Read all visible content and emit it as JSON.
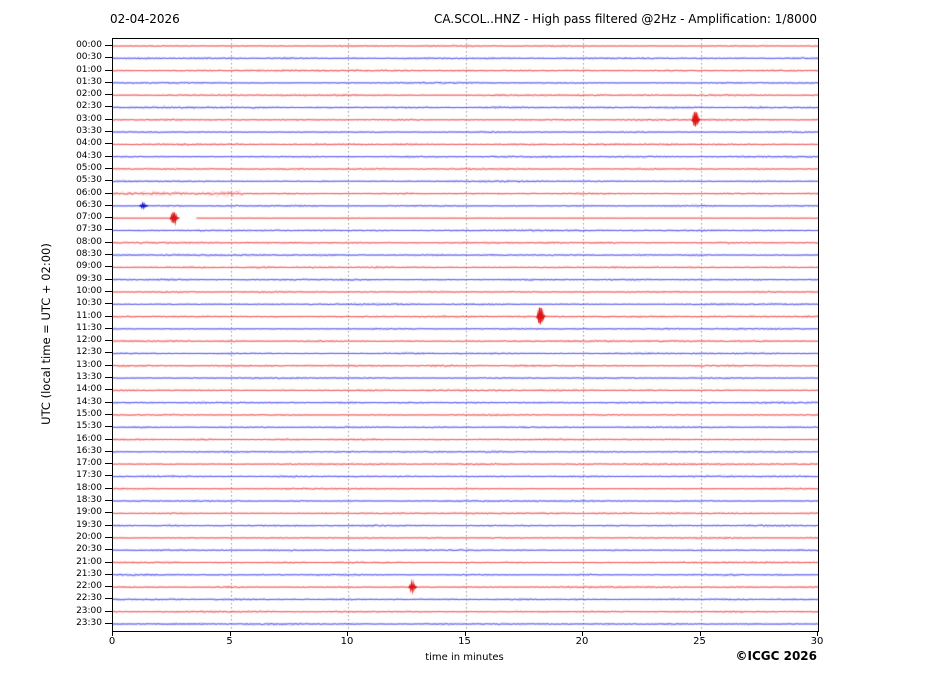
{
  "chart_data": {
    "type": "helicorder-seismogram",
    "title_left": "02-04-2026",
    "title_right": "CA.SCOL..HNZ - High pass filtered @2Hz - Amplification: 1/8000",
    "ylabel": "UTC (local time = UTC + 02:00)",
    "xlabel": "time in minutes",
    "copyright": "©ICGC 2026",
    "xlim": [
      0,
      30
    ],
    "xticks": [
      0,
      5,
      10,
      15,
      20,
      25,
      30
    ],
    "grid_minutes": [
      5,
      10,
      15,
      20,
      25
    ],
    "minutes_per_row": 30,
    "grid_on": true,
    "colors": {
      "hour_trace": "#ee3a3a",
      "half_trace": "#3a3aee",
      "event_red": "#dd1414",
      "event_blue": "#1414cc",
      "grid": "#999999",
      "axis": "#000000",
      "background": "#ffffff"
    },
    "rows": [
      {
        "label": "00:00",
        "color": "red"
      },
      {
        "label": "00:30",
        "color": "blue"
      },
      {
        "label": "01:00",
        "color": "red"
      },
      {
        "label": "01:30",
        "color": "blue"
      },
      {
        "label": "02:00",
        "color": "red"
      },
      {
        "label": "02:30",
        "color": "blue"
      },
      {
        "label": "03:00",
        "color": "red"
      },
      {
        "label": "03:30",
        "color": "blue"
      },
      {
        "label": "04:00",
        "color": "red"
      },
      {
        "label": "04:30",
        "color": "blue"
      },
      {
        "label": "05:00",
        "color": "red"
      },
      {
        "label": "05:30",
        "color": "blue"
      },
      {
        "label": "06:00",
        "color": "red"
      },
      {
        "label": "06:30",
        "color": "blue"
      },
      {
        "label": "07:00",
        "color": "red"
      },
      {
        "label": "07:30",
        "color": "blue"
      },
      {
        "label": "08:00",
        "color": "red"
      },
      {
        "label": "08:30",
        "color": "blue"
      },
      {
        "label": "09:00",
        "color": "red"
      },
      {
        "label": "09:30",
        "color": "blue"
      },
      {
        "label": "10:00",
        "color": "red"
      },
      {
        "label": "10:30",
        "color": "blue"
      },
      {
        "label": "11:00",
        "color": "red"
      },
      {
        "label": "11:30",
        "color": "blue"
      },
      {
        "label": "12:00",
        "color": "red"
      },
      {
        "label": "12:30",
        "color": "blue"
      },
      {
        "label": "13:00",
        "color": "red"
      },
      {
        "label": "13:30",
        "color": "blue"
      },
      {
        "label": "14:00",
        "color": "red"
      },
      {
        "label": "14:30",
        "color": "blue"
      },
      {
        "label": "15:00",
        "color": "red"
      },
      {
        "label": "15:30",
        "color": "blue"
      },
      {
        "label": "16:00",
        "color": "red"
      },
      {
        "label": "16:30",
        "color": "blue"
      },
      {
        "label": "17:00",
        "color": "red"
      },
      {
        "label": "17:30",
        "color": "blue"
      },
      {
        "label": "18:00",
        "color": "red"
      },
      {
        "label": "18:30",
        "color": "blue"
      },
      {
        "label": "19:00",
        "color": "red"
      },
      {
        "label": "19:30",
        "color": "blue"
      },
      {
        "label": "20:00",
        "color": "red"
      },
      {
        "label": "20:30",
        "color": "blue"
      },
      {
        "label": "21:00",
        "color": "red"
      },
      {
        "label": "21:30",
        "color": "blue"
      },
      {
        "label": "22:00",
        "color": "red"
      },
      {
        "label": "22:30",
        "color": "blue"
      },
      {
        "label": "23:00",
        "color": "red"
      },
      {
        "label": "23:30",
        "color": "blue"
      }
    ],
    "events": [
      {
        "row": "03:00",
        "minute": 24.8,
        "amplitude": 8
      },
      {
        "row": "06:30",
        "minute": 1.3,
        "amplitude": 2
      },
      {
        "row": "07:00",
        "minute": 2.6,
        "amplitude": 6,
        "gap_minutes": [
          2.85,
          3.55
        ]
      },
      {
        "row": "11:00",
        "minute": 18.2,
        "amplitude": 9
      },
      {
        "row": "22:00",
        "minute": 12.75,
        "amplitude": 4
      }
    ],
    "noisy_segments": [
      {
        "row": "06:00",
        "from_minute": 0,
        "to_minute": 5.5,
        "boost": 2.4
      }
    ],
    "quiet_rows": [
      "07:00"
    ]
  }
}
